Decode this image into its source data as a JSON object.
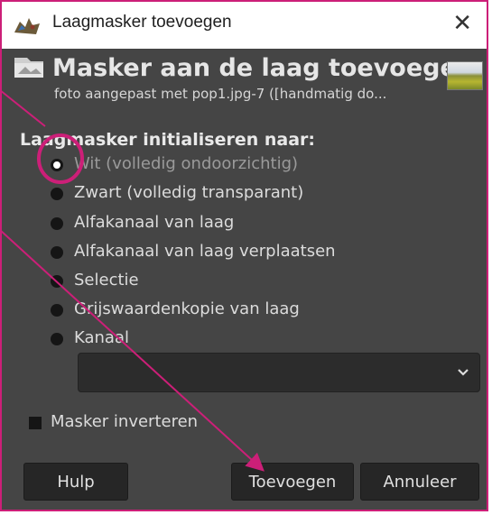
{
  "window": {
    "title": "Laagmasker toevoegen",
    "close_glyph": "✕"
  },
  "header": {
    "title": "Masker aan de laag toevoegen",
    "subtitle": "foto aangepast met pop1.jpg-7 ([handmatig do..."
  },
  "options": {
    "group_label": "Laagmasker initialiseren naar:",
    "items": [
      {
        "label": "Wit (volledig ondoorzichtig)",
        "selected": true
      },
      {
        "label": "Zwart (volledig transparant)",
        "selected": false
      },
      {
        "label": "Alfakanaal van laag",
        "selected": false
      },
      {
        "label": "Alfakanaal van laag verplaatsen",
        "selected": false
      },
      {
        "label": "Selectie",
        "selected": false
      },
      {
        "label": "Grijswaardenkopie van laag",
        "selected": false
      },
      {
        "label": "Kanaal",
        "selected": false
      }
    ],
    "channel_select_value": "",
    "invert_label": "Masker inverteren",
    "invert_checked": false
  },
  "buttons": {
    "help": "Hulp",
    "add": "Toevoegen",
    "cancel": "Annuleer"
  },
  "colors": {
    "dialog_bg": "#454545",
    "annotation": "#cc1f78"
  }
}
